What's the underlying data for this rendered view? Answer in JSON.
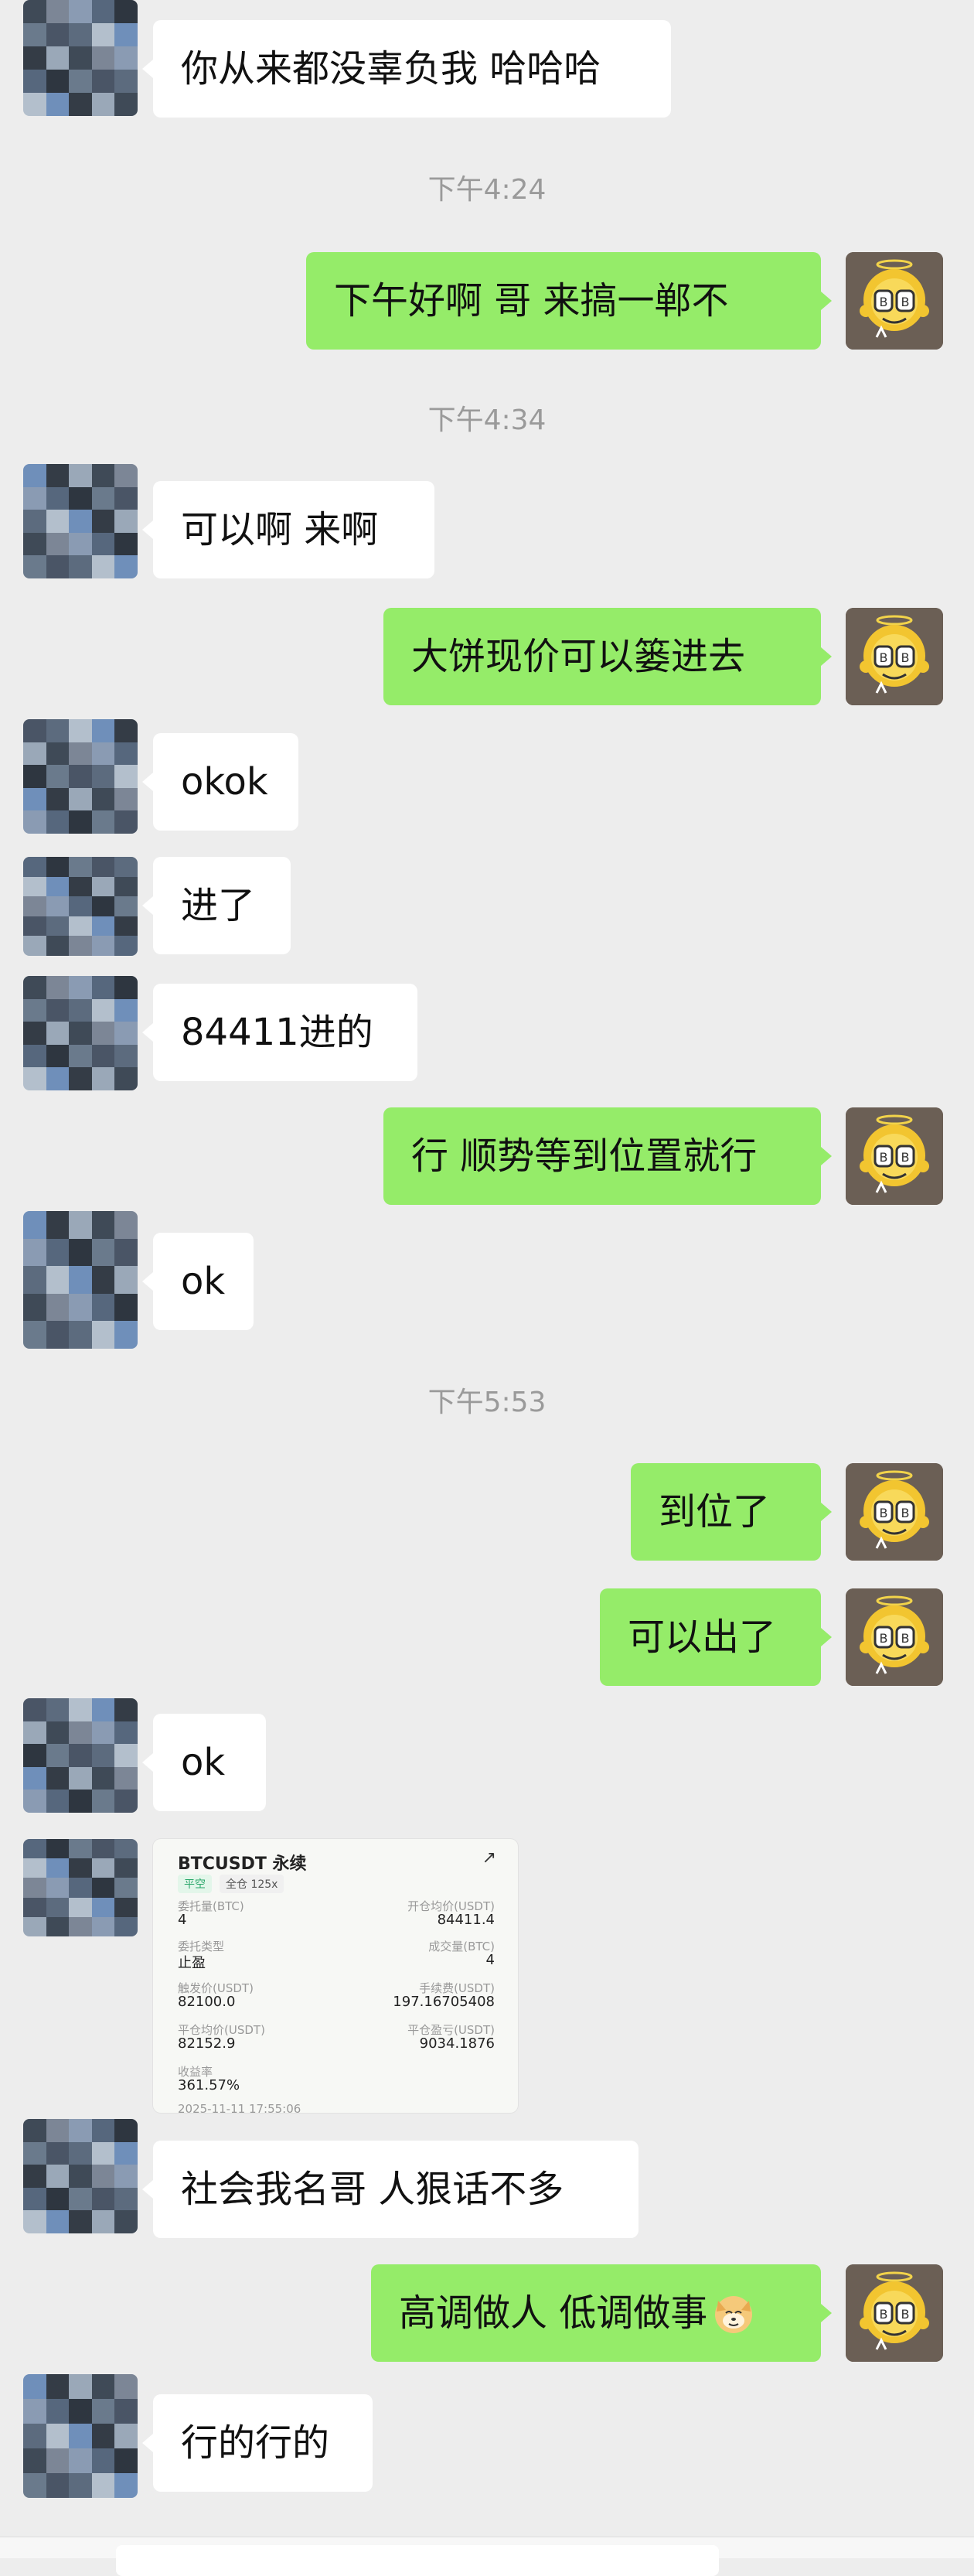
{
  "chat": {
    "timestamps": [
      "下午4:24",
      "下午4:34",
      "下午5:53"
    ],
    "messages": [
      {
        "side": "in",
        "text": "你从来都没辜负我 哈哈哈"
      },
      {
        "side": "out",
        "text": "下午好啊 哥 来搞一郸不"
      },
      {
        "side": "in",
        "text": "可以啊 来啊"
      },
      {
        "side": "out",
        "text": "大饼现价可以篓进去"
      },
      {
        "side": "in",
        "text": "okok"
      },
      {
        "side": "in",
        "text": "进了"
      },
      {
        "side": "in",
        "text": "84411进的"
      },
      {
        "side": "out",
        "text": "行 顺势等到位置就行"
      },
      {
        "side": "in",
        "text": "ok"
      },
      {
        "side": "out",
        "text": "到位了"
      },
      {
        "side": "out",
        "text": "可以出了"
      },
      {
        "side": "in",
        "text": "ok"
      },
      {
        "side": "in",
        "text": "社会我名哥 人狠话不多"
      },
      {
        "side": "out",
        "text": "高调做人 低调做事"
      },
      {
        "side": "in",
        "text": "行的行的"
      }
    ],
    "trade_card": {
      "title": "BTCUSDT 永续",
      "tag_side": "平空",
      "tag_mode": "全仓 125x",
      "fields": [
        {
          "label": "委托量(BTC)",
          "value": "4"
        },
        {
          "label": "开仓均价(USDT)",
          "value": "84411.4"
        },
        {
          "label": "委托类型",
          "value": "止盈"
        },
        {
          "label": "成交量(BTC)",
          "value": "4"
        },
        {
          "label": "触发价(USDT)",
          "value": "82100.0"
        },
        {
          "label": "手续费(USDT)",
          "value": "197.16705408"
        },
        {
          "label": "平仓均价(USDT)",
          "value": "82152.9"
        },
        {
          "label": "平仓盈亏(USDT)",
          "value": "9034.1876"
        },
        {
          "label": "收益率",
          "value": "361.57%"
        }
      ],
      "footer": "2025-11-11 17:55:06"
    }
  },
  "colors": {
    "background": "#ededed",
    "outgoing_bubble": "#95ec69",
    "incoming_bubble": "#ffffff",
    "timestamp": "#9a9a9a"
  }
}
